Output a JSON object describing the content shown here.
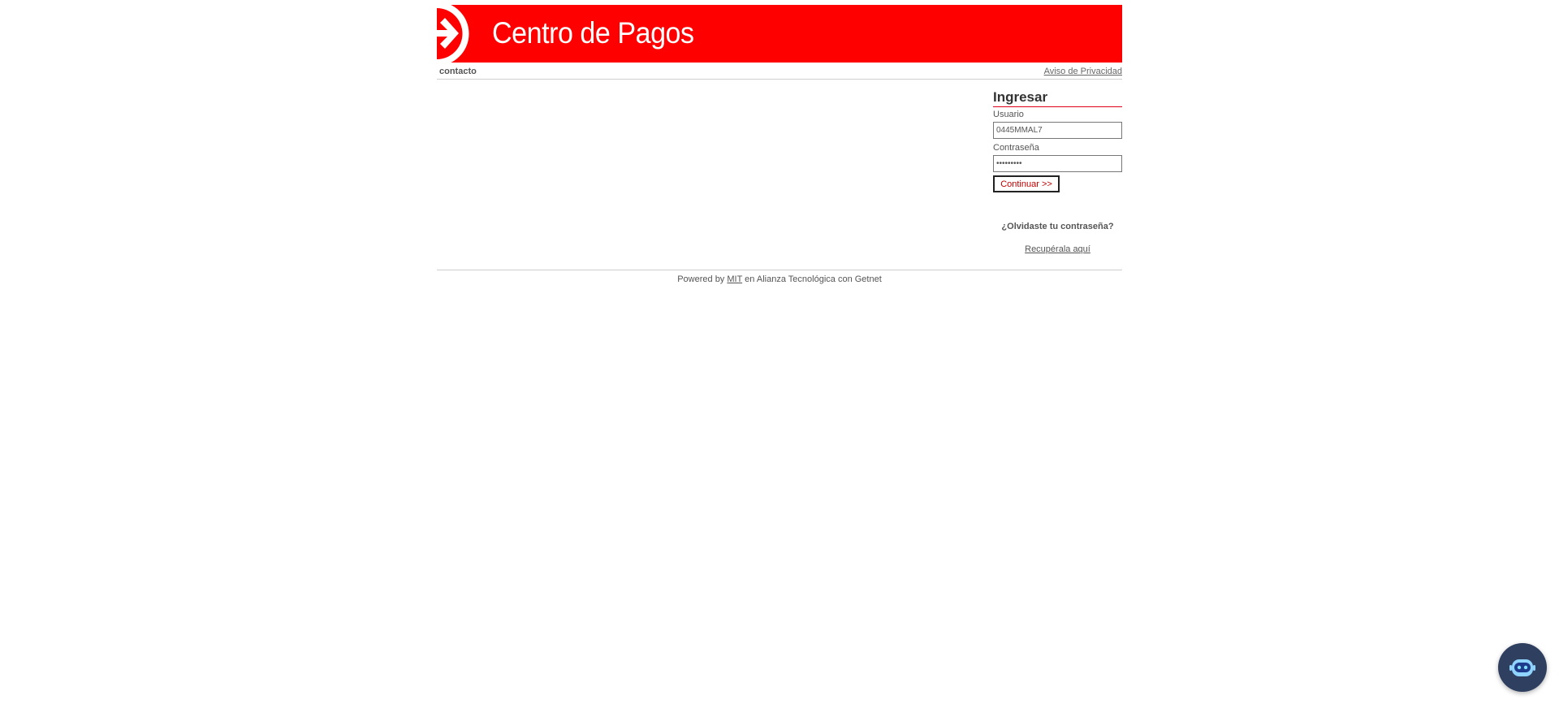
{
  "header": {
    "title": "Centro de Pagos",
    "brand_color": "#ff0000"
  },
  "nav": {
    "contact_label": "contacto",
    "privacy_label": "Aviso de Privacidad"
  },
  "login": {
    "title": "Ingresar",
    "user_label": "Usuario",
    "user_value": "0445MMAL7",
    "password_label": "Contraseña",
    "password_value": "•••••••••",
    "submit_label": "Continuar >>",
    "forgot_question": "¿Olvidaste tu contraseña?",
    "recover_link": "Recupérala aquí"
  },
  "footer": {
    "prefix": "Powered by ",
    "mit_link": "MIT",
    "suffix": " en Alianza Tecnológica con Getnet"
  },
  "chat": {
    "icon": "robot-chat-icon"
  }
}
